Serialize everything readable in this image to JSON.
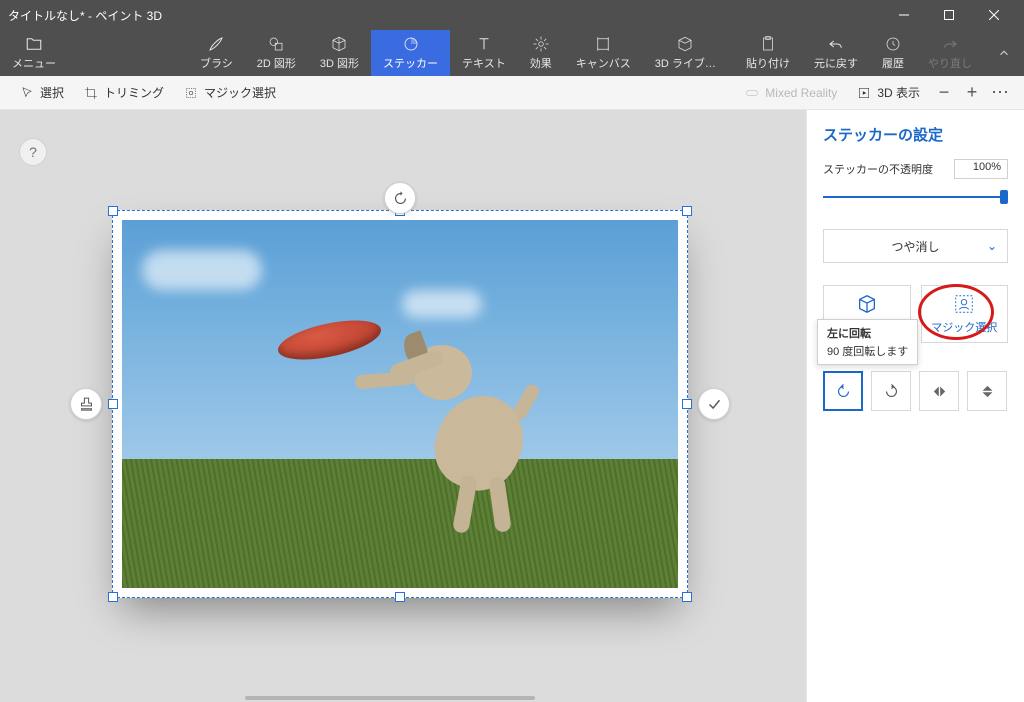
{
  "titlebar": {
    "title": "タイトルなし* - ペイント 3D"
  },
  "ribbon": {
    "menu": "メニュー",
    "brush": "ブラシ",
    "shapes2d": "2D 図形",
    "shapes3d": "3D 図形",
    "sticker": "ステッカー",
    "text": "テキスト",
    "effects": "効果",
    "canvas": "キャンバス",
    "lib3d": "3D ライブ…",
    "paste": "貼り付け",
    "undo": "元に戻す",
    "history": "履歴",
    "redo": "やり直し"
  },
  "subtoolbar": {
    "select": "選択",
    "trimming": "トリミング",
    "magic": "マジック選択",
    "mixed": "Mixed Reality",
    "view3d": "3D 表示"
  },
  "help": "?",
  "panel": {
    "title": "ステッカーの設定",
    "opacity_label": "ステッカーの不透明度",
    "opacity_value": "100%",
    "matte": "つや消し",
    "make3d": "3D の作成",
    "magic": "マジック選択",
    "tooltip_title": "左に回転",
    "tooltip_body": "90 度回転します"
  }
}
